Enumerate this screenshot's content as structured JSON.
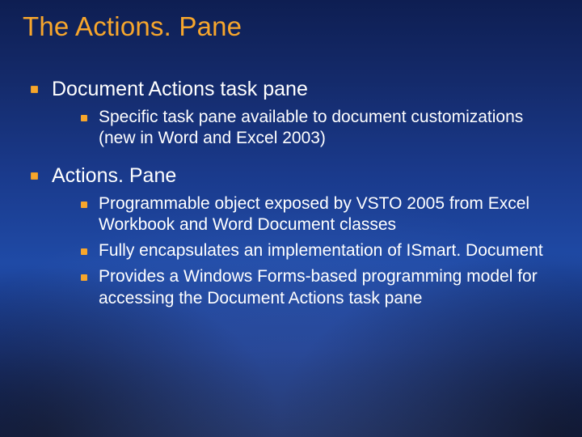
{
  "title": "The Actions. Pane",
  "bullets": [
    {
      "text": "Document Actions task pane",
      "children": [
        "Specific task pane available to document customizations (new in Word and Excel 2003)"
      ]
    },
    {
      "text": "Actions. Pane",
      "children": [
        "Programmable object exposed by VSTO 2005 from Excel Workbook and Word Document classes",
        "Fully encapsulates an implementation of ISmart. Document",
        "Provides a Windows Forms-based programming model for accessing the Document Actions task pane"
      ]
    }
  ]
}
